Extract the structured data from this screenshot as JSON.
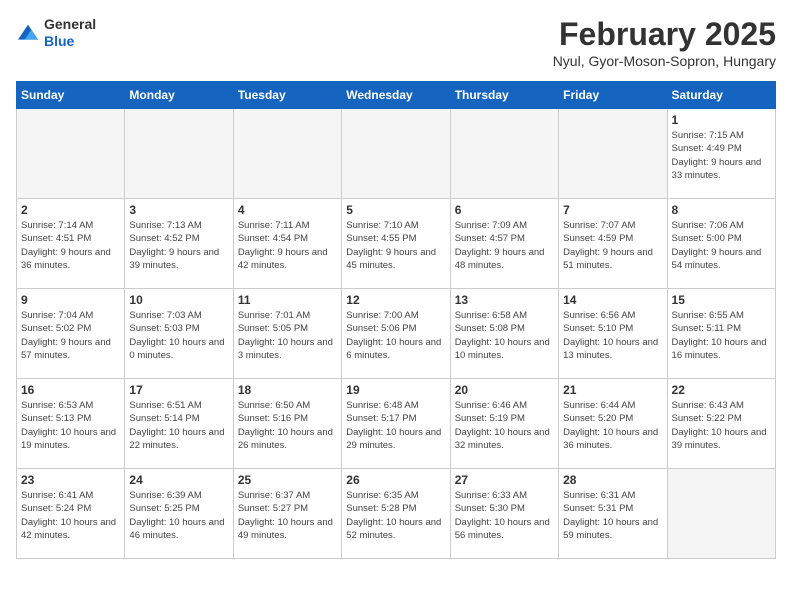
{
  "header": {
    "logo_general": "General",
    "logo_blue": "Blue",
    "month_title": "February 2025",
    "location": "Nyul, Gyor-Moson-Sopron, Hungary"
  },
  "weekdays": [
    "Sunday",
    "Monday",
    "Tuesday",
    "Wednesday",
    "Thursday",
    "Friday",
    "Saturday"
  ],
  "weeks": [
    [
      {
        "num": "",
        "info": ""
      },
      {
        "num": "",
        "info": ""
      },
      {
        "num": "",
        "info": ""
      },
      {
        "num": "",
        "info": ""
      },
      {
        "num": "",
        "info": ""
      },
      {
        "num": "",
        "info": ""
      },
      {
        "num": "1",
        "info": "Sunrise: 7:15 AM\nSunset: 4:49 PM\nDaylight: 9 hours and 33 minutes."
      }
    ],
    [
      {
        "num": "2",
        "info": "Sunrise: 7:14 AM\nSunset: 4:51 PM\nDaylight: 9 hours and 36 minutes."
      },
      {
        "num": "3",
        "info": "Sunrise: 7:13 AM\nSunset: 4:52 PM\nDaylight: 9 hours and 39 minutes."
      },
      {
        "num": "4",
        "info": "Sunrise: 7:11 AM\nSunset: 4:54 PM\nDaylight: 9 hours and 42 minutes."
      },
      {
        "num": "5",
        "info": "Sunrise: 7:10 AM\nSunset: 4:55 PM\nDaylight: 9 hours and 45 minutes."
      },
      {
        "num": "6",
        "info": "Sunrise: 7:09 AM\nSunset: 4:57 PM\nDaylight: 9 hours and 48 minutes."
      },
      {
        "num": "7",
        "info": "Sunrise: 7:07 AM\nSunset: 4:59 PM\nDaylight: 9 hours and 51 minutes."
      },
      {
        "num": "8",
        "info": "Sunrise: 7:06 AM\nSunset: 5:00 PM\nDaylight: 9 hours and 54 minutes."
      }
    ],
    [
      {
        "num": "9",
        "info": "Sunrise: 7:04 AM\nSunset: 5:02 PM\nDaylight: 9 hours and 57 minutes."
      },
      {
        "num": "10",
        "info": "Sunrise: 7:03 AM\nSunset: 5:03 PM\nDaylight: 10 hours and 0 minutes."
      },
      {
        "num": "11",
        "info": "Sunrise: 7:01 AM\nSunset: 5:05 PM\nDaylight: 10 hours and 3 minutes."
      },
      {
        "num": "12",
        "info": "Sunrise: 7:00 AM\nSunset: 5:06 PM\nDaylight: 10 hours and 6 minutes."
      },
      {
        "num": "13",
        "info": "Sunrise: 6:58 AM\nSunset: 5:08 PM\nDaylight: 10 hours and 10 minutes."
      },
      {
        "num": "14",
        "info": "Sunrise: 6:56 AM\nSunset: 5:10 PM\nDaylight: 10 hours and 13 minutes."
      },
      {
        "num": "15",
        "info": "Sunrise: 6:55 AM\nSunset: 5:11 PM\nDaylight: 10 hours and 16 minutes."
      }
    ],
    [
      {
        "num": "16",
        "info": "Sunrise: 6:53 AM\nSunset: 5:13 PM\nDaylight: 10 hours and 19 minutes."
      },
      {
        "num": "17",
        "info": "Sunrise: 6:51 AM\nSunset: 5:14 PM\nDaylight: 10 hours and 22 minutes."
      },
      {
        "num": "18",
        "info": "Sunrise: 6:50 AM\nSunset: 5:16 PM\nDaylight: 10 hours and 26 minutes."
      },
      {
        "num": "19",
        "info": "Sunrise: 6:48 AM\nSunset: 5:17 PM\nDaylight: 10 hours and 29 minutes."
      },
      {
        "num": "20",
        "info": "Sunrise: 6:46 AM\nSunset: 5:19 PM\nDaylight: 10 hours and 32 minutes."
      },
      {
        "num": "21",
        "info": "Sunrise: 6:44 AM\nSunset: 5:20 PM\nDaylight: 10 hours and 36 minutes."
      },
      {
        "num": "22",
        "info": "Sunrise: 6:43 AM\nSunset: 5:22 PM\nDaylight: 10 hours and 39 minutes."
      }
    ],
    [
      {
        "num": "23",
        "info": "Sunrise: 6:41 AM\nSunset: 5:24 PM\nDaylight: 10 hours and 42 minutes."
      },
      {
        "num": "24",
        "info": "Sunrise: 6:39 AM\nSunset: 5:25 PM\nDaylight: 10 hours and 46 minutes."
      },
      {
        "num": "25",
        "info": "Sunrise: 6:37 AM\nSunset: 5:27 PM\nDaylight: 10 hours and 49 minutes."
      },
      {
        "num": "26",
        "info": "Sunrise: 6:35 AM\nSunset: 5:28 PM\nDaylight: 10 hours and 52 minutes."
      },
      {
        "num": "27",
        "info": "Sunrise: 6:33 AM\nSunset: 5:30 PM\nDaylight: 10 hours and 56 minutes."
      },
      {
        "num": "28",
        "info": "Sunrise: 6:31 AM\nSunset: 5:31 PM\nDaylight: 10 hours and 59 minutes."
      },
      {
        "num": "",
        "info": ""
      }
    ]
  ]
}
